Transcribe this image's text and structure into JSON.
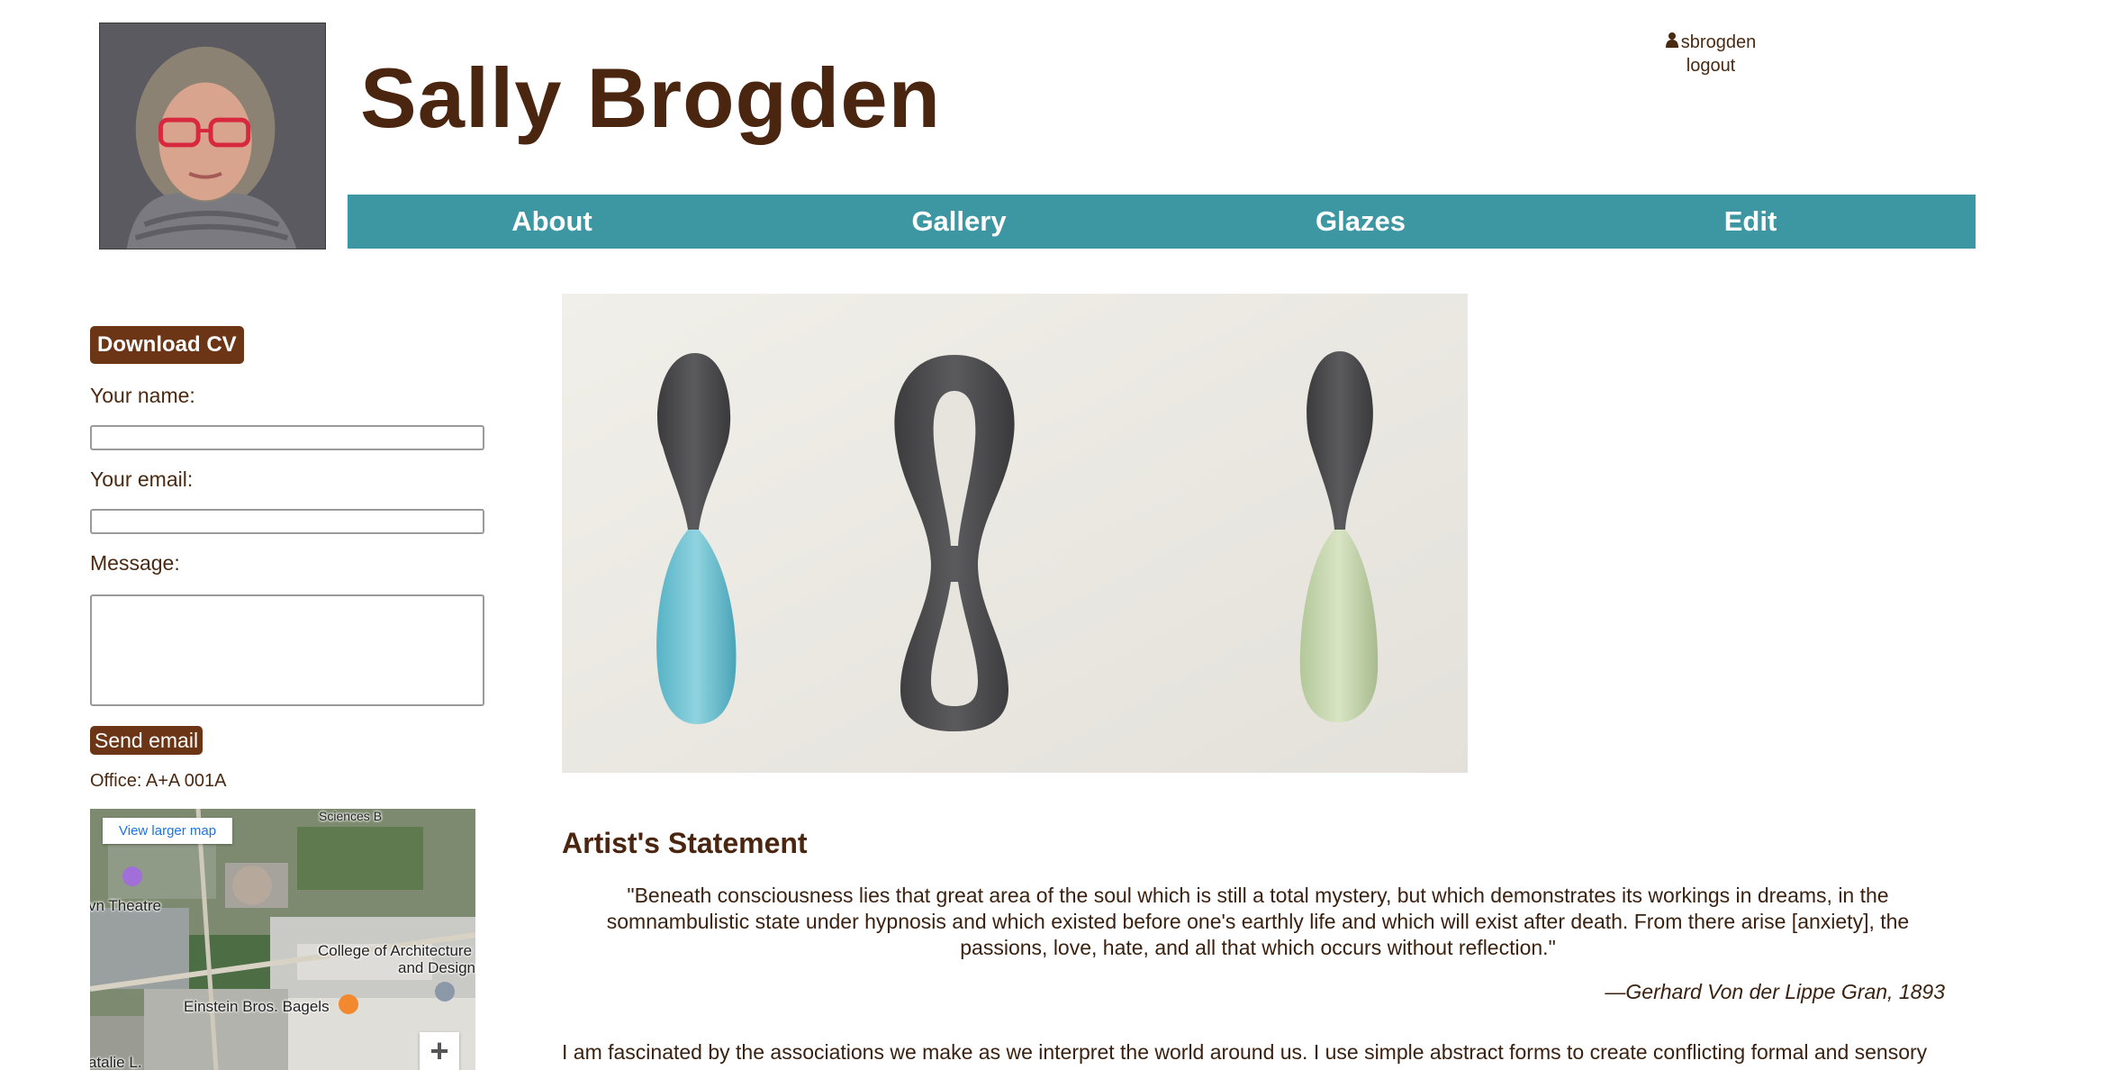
{
  "header": {
    "site_title": "Sally Brogden",
    "username": "sbrogden",
    "logout_label": "logout"
  },
  "nav": {
    "items": [
      {
        "label": "About"
      },
      {
        "label": "Gallery"
      },
      {
        "label": "Glazes"
      },
      {
        "label": "Edit"
      }
    ],
    "color": "#3d97a3"
  },
  "sidebar": {
    "download_cv_label": "Download CV",
    "name_label": "Your name:",
    "name_value": "",
    "email_label": "Your email:",
    "email_value": "",
    "message_label": "Message:",
    "message_value": "",
    "send_label": "Send email",
    "office": "Office: A+A 001A",
    "button_color": "#6b3516"
  },
  "map": {
    "view_larger_label": "View larger map",
    "zoom_in_label": "+",
    "labels": {
      "theatre": "vn Theatre",
      "college1": "College of Architecture",
      "college2": "and Design",
      "bagels": "Einstein Bros. Bagels",
      "sciences": "Sciences B",
      "natalie": "atalie L."
    }
  },
  "main": {
    "statement_title": "Artist's Statement",
    "quote": "\"Beneath consciousness lies that great area of the soul which is still a total mystery, but which demonstrates its workings in dreams, in the somnambulistic state under hypnosis and which existed before one's earthly life and which will exist after death. From there arise [anxiety], the passions, love, hate, and all that which occurs without reflection.\"",
    "attribution": "—Gerhard Von der Lippe Gran, 1893",
    "body": "I am fascinated by the associations we make as we interpret the world around us. I use simple abstract forms to create conflicting formal and sensory associations: hard/soft, precise/imperfect, strong/vulnerable. My works are inspired by human form, nature, and mass produced objects. Embracing the"
  },
  "colors": {
    "title_brown": "#4a2510",
    "text_brown": "#3b2210"
  }
}
